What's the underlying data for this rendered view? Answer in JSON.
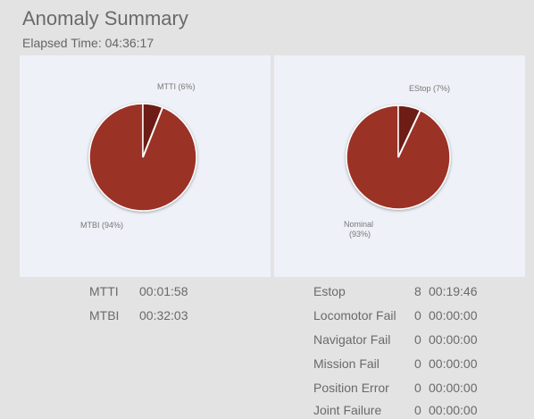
{
  "header": {
    "title": "Anomaly Summary",
    "elapsed_label": "Elapsed Time:",
    "elapsed_value": "04:36:17"
  },
  "pies": {
    "left": {
      "small": {
        "label": "MTTI (6%)",
        "percent": 6,
        "color": "#6d1e15"
      },
      "large": {
        "label": "MTBI (94%)",
        "percent": 94,
        "color": "#9b3328"
      }
    },
    "right": {
      "small": {
        "label": "EStop (7%)",
        "percent": 7,
        "color": "#6d1e15"
      },
      "large": {
        "label_line1": "Nominal",
        "label_line2": "(93%)",
        "percent": 93,
        "color": "#9b3328"
      }
    }
  },
  "left_stats": [
    {
      "name": "MTTI",
      "time": "00:01:58"
    },
    {
      "name": "MTBI",
      "time": "00:32:03"
    }
  ],
  "right_stats": [
    {
      "name": "Estop",
      "count": "8",
      "time": "00:19:46"
    },
    {
      "name": "Locomotor Fail",
      "count": "0",
      "time": "00:00:00"
    },
    {
      "name": "Navigator Fail",
      "count": "0",
      "time": "00:00:00"
    },
    {
      "name": "Mission Fail",
      "count": "0",
      "time": "00:00:00"
    },
    {
      "name": "Position Error",
      "count": "0",
      "time": "00:00:00"
    },
    {
      "name": "Joint Failure",
      "count": "0",
      "time": "00:00:00"
    }
  ]
}
